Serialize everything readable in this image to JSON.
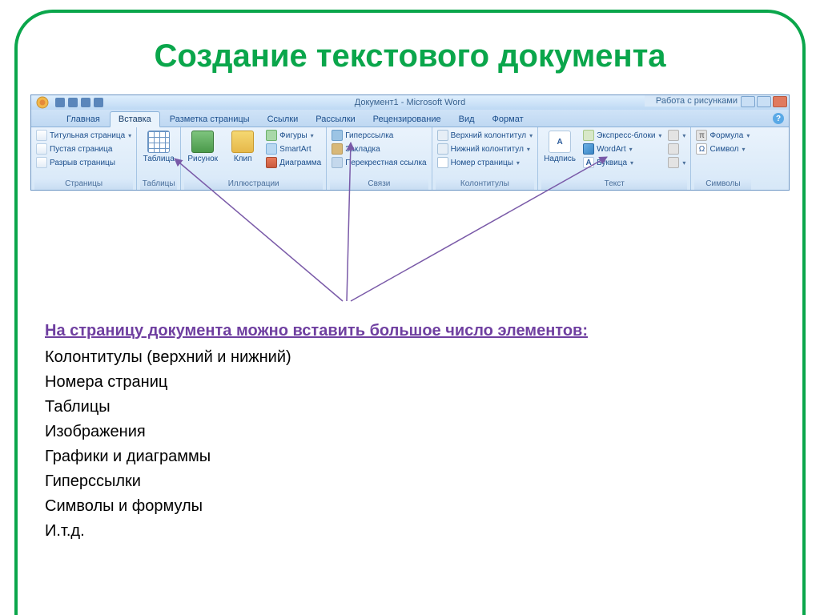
{
  "slide": {
    "title": "Создание текстового документа"
  },
  "word": {
    "doc_title": "Документ1 - Microsoft Word",
    "contextual_label": "Работа с рисунками",
    "tabs": {
      "home": "Главная",
      "insert": "Вставка",
      "layout": "Разметка страницы",
      "refs": "Ссылки",
      "mail": "Рассылки",
      "review": "Рецензирование",
      "view": "Вид",
      "format": "Формат"
    },
    "groups": {
      "pages": {
        "label": "Страницы",
        "cover": "Титульная страница",
        "blank": "Пустая страница",
        "break": "Разрыв страницы"
      },
      "tables": {
        "label": "Таблицы",
        "table": "Таблица"
      },
      "illus": {
        "label": "Иллюстрации",
        "pic": "Рисунок",
        "clip": "Клип",
        "shapes": "Фигуры",
        "smart": "SmartArt",
        "chart": "Диаграмма"
      },
      "links": {
        "label": "Связи",
        "hyper": "Гиперссылка",
        "bm": "Закладка",
        "xref": "Перекрестная ссылка"
      },
      "hf": {
        "label": "Колонтитулы",
        "header": "Верхний колонтитул",
        "footer": "Нижний колонтитул",
        "page": "Номер страницы"
      },
      "text": {
        "label": "Текст",
        "textbox": "Надпись",
        "quick": "Экспресс-блоки",
        "wordart": "WordArt",
        "drop": "Буквица"
      },
      "symbols": {
        "label": "Символы",
        "eq": "Формула",
        "sym": "Символ"
      }
    }
  },
  "body": {
    "lead": "На страницу документа можно вставить большое число элементов:",
    "items": [
      "Колонтитулы (верхний и нижний)",
      "Номера страниц",
      "Таблицы",
      "Изображения",
      "Графики и диаграммы",
      "Гиперссылки",
      "Символы и формулы",
      "И.т.д."
    ]
  }
}
